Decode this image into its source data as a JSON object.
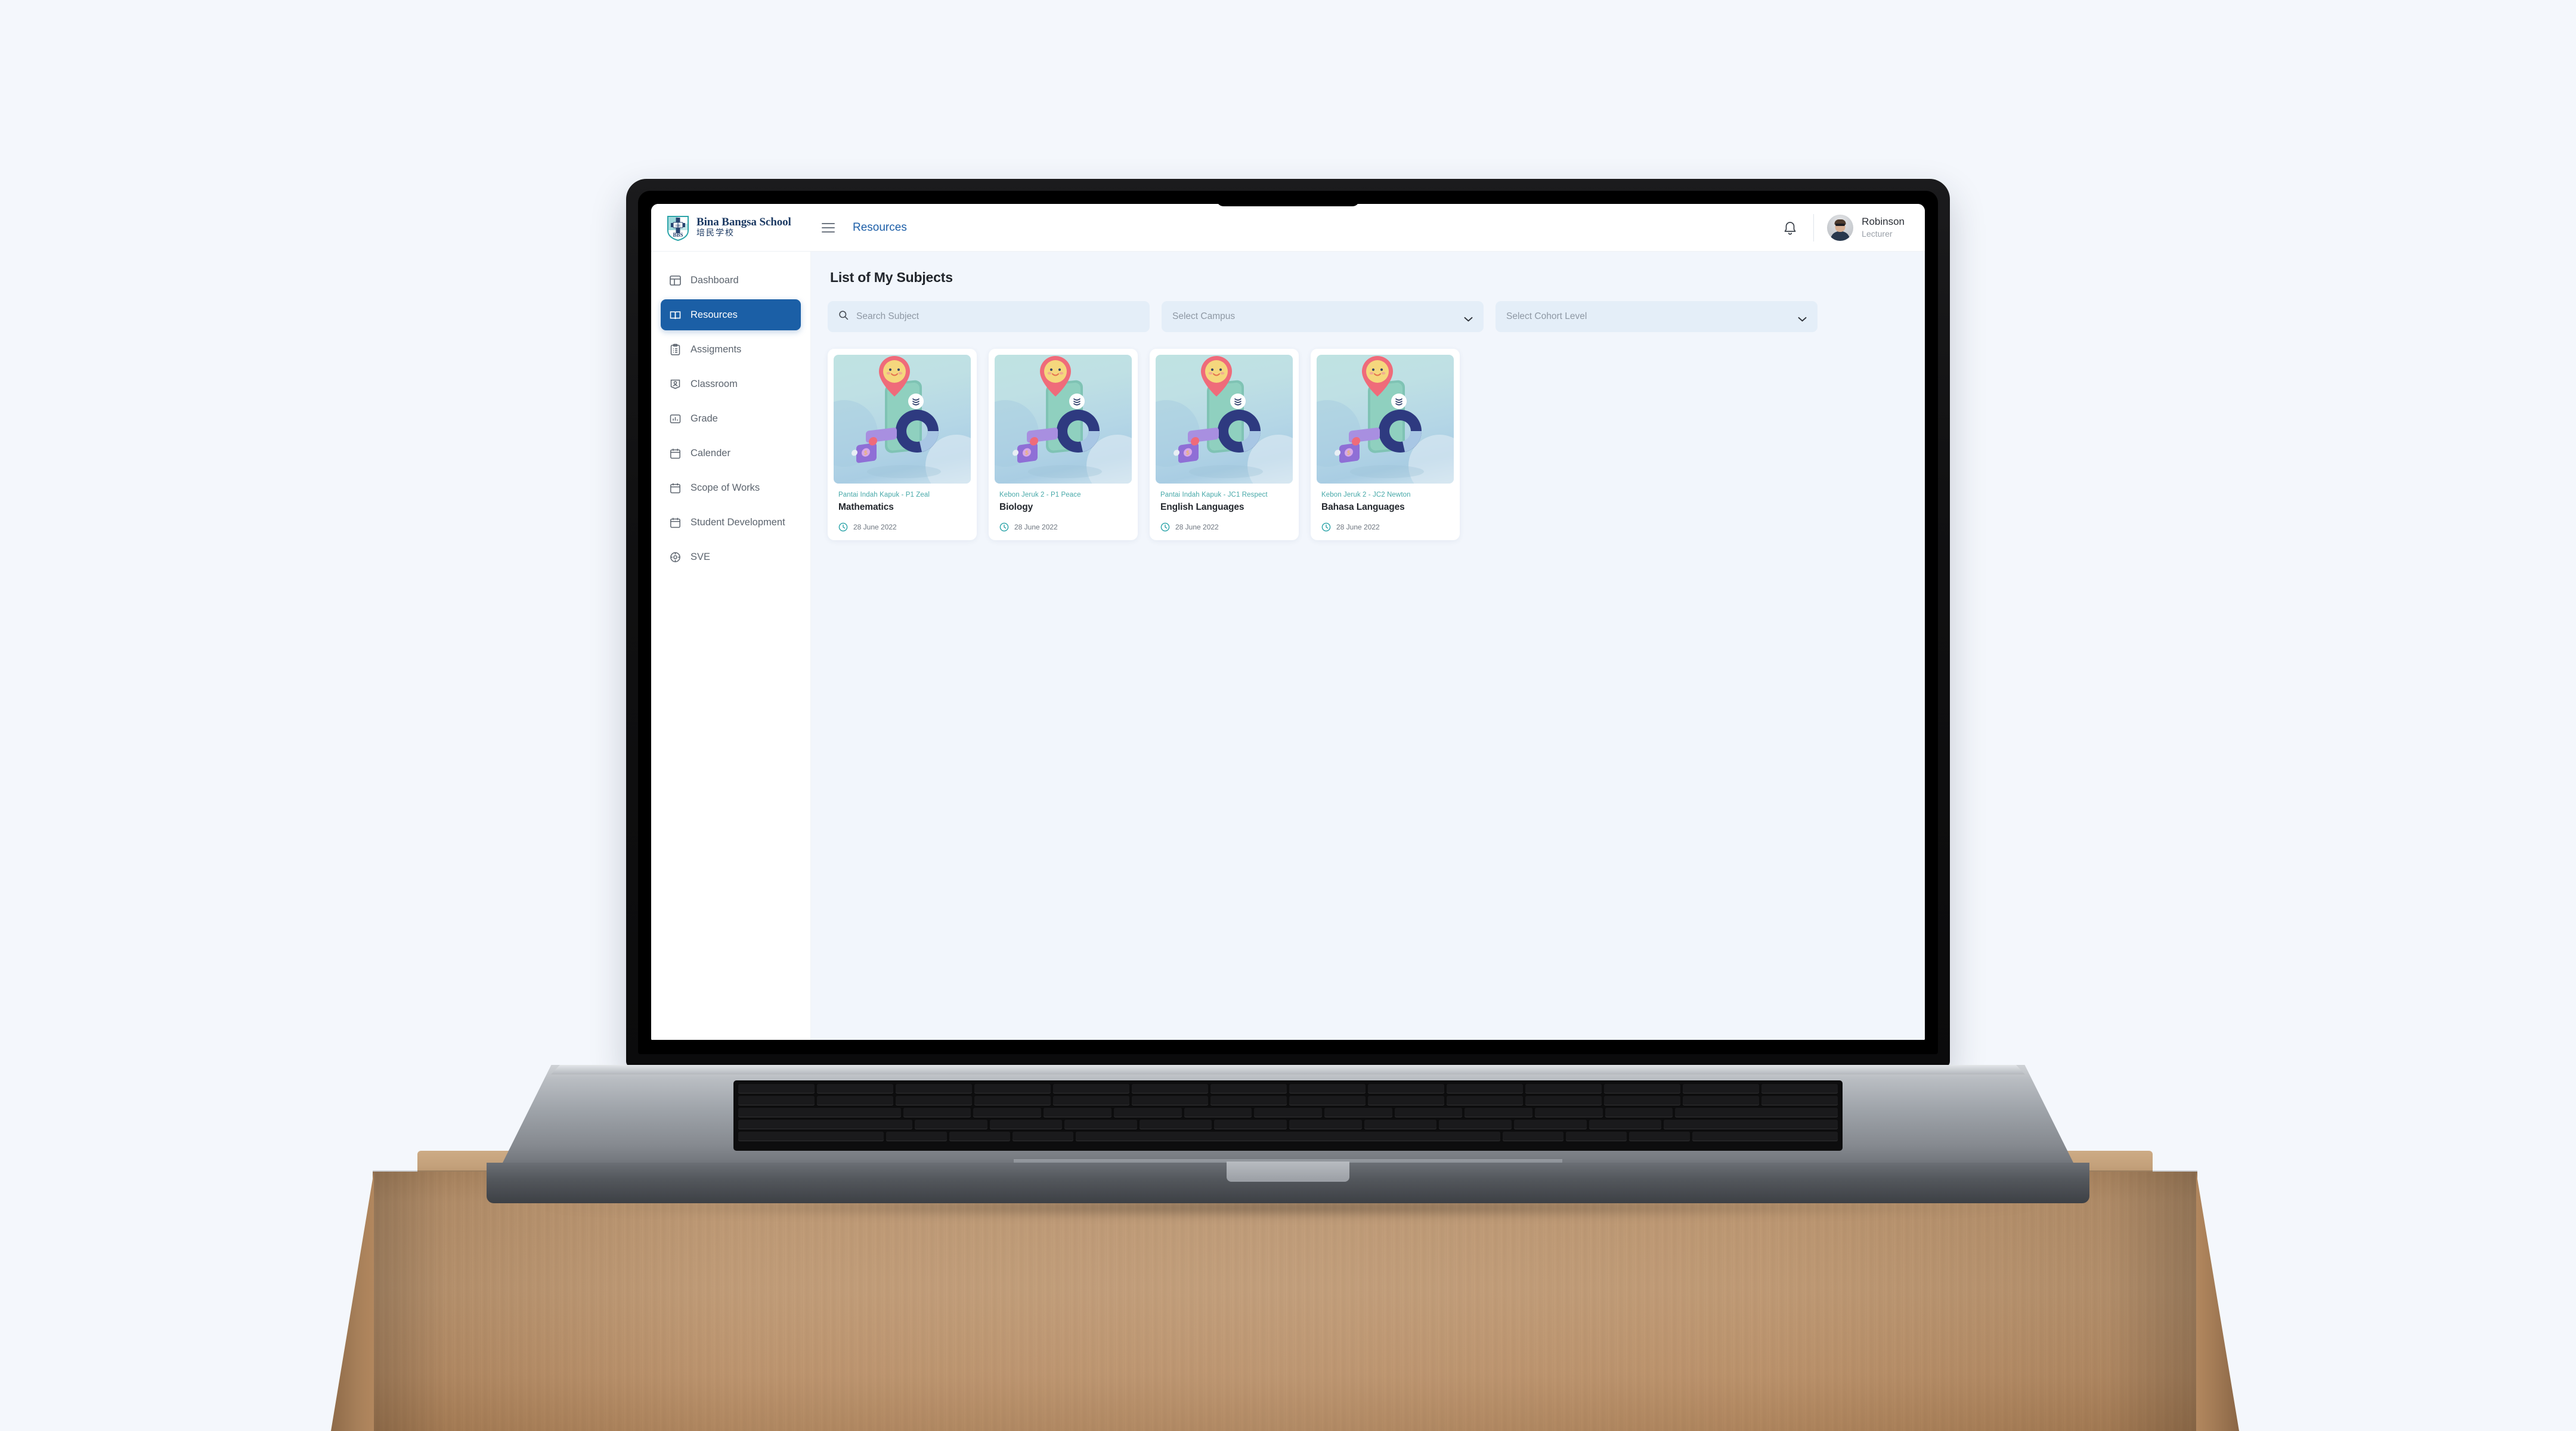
{
  "app": {
    "brand_name_en": "Bina Bangsa School",
    "brand_name_cn": "培民学校",
    "breadcrumb": "Resources",
    "menu_icon": "hamburger-icon",
    "notification_icon": "bell-icon"
  },
  "user": {
    "name": "Robinson",
    "role": "Lecturer",
    "avatar_icon": "user-avatar"
  },
  "sidebar": {
    "items": [
      {
        "label": "Dashboard",
        "icon": "dashboard-icon",
        "active": false
      },
      {
        "label": "Resources",
        "icon": "book-icon",
        "active": true
      },
      {
        "label": "Assigments",
        "icon": "clipboard-icon",
        "active": false
      },
      {
        "label": "Classroom",
        "icon": "user-card-icon",
        "active": false
      },
      {
        "label": "Grade",
        "icon": "bar-chart-icon",
        "active": false
      },
      {
        "label": "Calender",
        "icon": "calendar-icon",
        "active": false
      },
      {
        "label": "Scope of Works",
        "icon": "calendar-icon",
        "active": false
      },
      {
        "label": "Student Development",
        "icon": "calendar-icon",
        "active": false
      },
      {
        "label": "SVE",
        "icon": "compass-icon",
        "active": false
      }
    ]
  },
  "main": {
    "page_title": "List of My Subjects",
    "search": {
      "placeholder": "Search Subject",
      "value": "",
      "icon": "search-icon"
    },
    "campus_select": {
      "placeholder": "Select Campus",
      "value": "",
      "icon": "chevron-down-icon"
    },
    "cohort_select": {
      "placeholder": "Select Cohort Level",
      "value": "",
      "icon": "chevron-down-icon"
    },
    "cards": [
      {
        "campus": "Pantai Indah Kapuk - P1 Zeal",
        "subject": "Mathematics",
        "date": "28 June 2022",
        "date_icon": "clock-icon"
      },
      {
        "campus": "Kebon Jeruk 2 - P1 Peace",
        "subject": "Biology",
        "date": "28 June 2022",
        "date_icon": "clock-icon"
      },
      {
        "campus": "Pantai Indah Kapuk - JC1 Respect",
        "subject": "English Languages",
        "date": "28 June 2022",
        "date_icon": "clock-icon"
      },
      {
        "campus": "Kebon Jeruk 2 - JC2 Newton",
        "subject": "Bahasa Languages",
        "date": "28 June 2022",
        "date_icon": "clock-icon"
      }
    ]
  },
  "colors": {
    "page_background": "#f4f7fc",
    "content_background": "#f2f6fc",
    "accent_blue": "#1b5fa6",
    "breadcrumb_blue": "#1d5fa8",
    "campus_teal": "#46a8a8",
    "field_background": "#e4eef8",
    "desk_wood": "#bc9670"
  }
}
